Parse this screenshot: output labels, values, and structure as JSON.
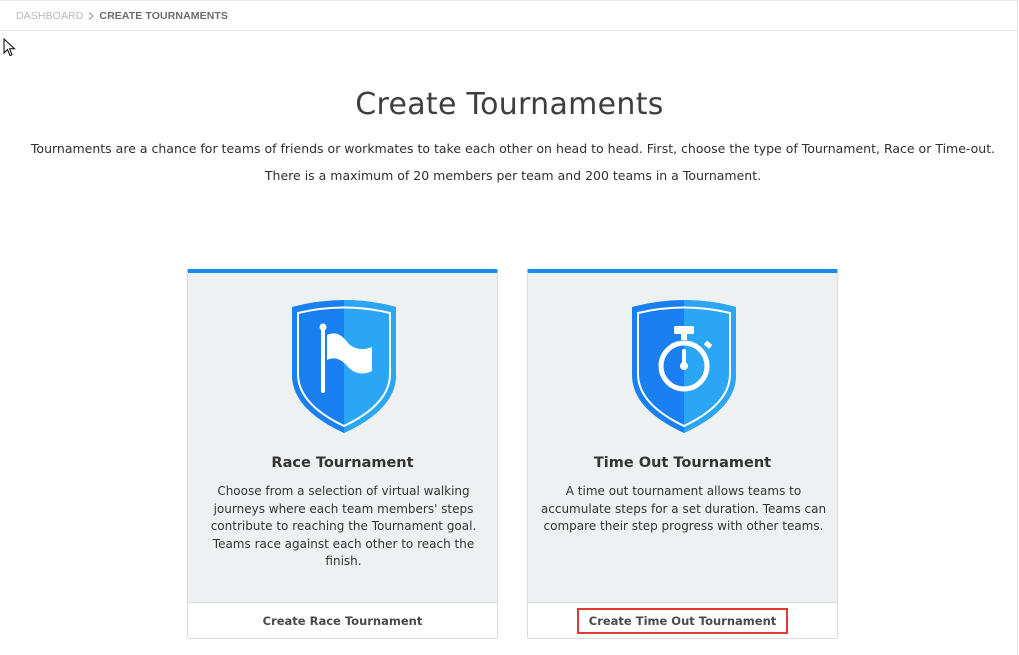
{
  "breadcrumb": {
    "items": [
      "DASHBOARD",
      "CREATE TOURNAMENTS"
    ]
  },
  "page": {
    "title": "Create Tournaments",
    "intro_line1": "Tournaments are a chance for teams of friends or workmates to take each other on head to head. First, choose the type of Tournament, Race or Time-out.",
    "intro_line2": "There is a maximum of 20 members per team and 200 teams in a Tournament."
  },
  "cards": [
    {
      "title": "Race Tournament",
      "description": "Choose from a selection of virtual walking journeys where each team members' steps contribute to reaching the Tournament goal. Teams race against each other to reach the finish.",
      "button_label": "Create Race Tournament",
      "icon": "flag-shield-icon"
    },
    {
      "title": "Time Out Tournament",
      "description": "A time out tournament allows teams to accumulate steps for a set duration. Teams can compare their step progress with other teams.",
      "button_label": "Create Time Out Tournament",
      "icon": "stopwatch-shield-icon",
      "highlighted": true
    }
  ],
  "colors": {
    "accent": "#1a8cf0",
    "shield_dark": "#1a7ff0",
    "shield_light": "#2aa6f5",
    "highlight": "#e53935"
  }
}
